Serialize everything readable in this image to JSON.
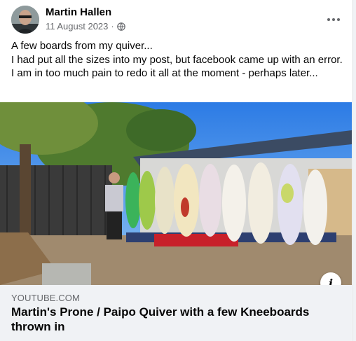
{
  "post": {
    "author": "Martin Hallen",
    "date": "11 August 2023",
    "privacy_icon": "globe-icon",
    "more_icon": "more-horizontal-icon",
    "text_lines": [
      "A few boards from my quiver...",
      "I had put all the sizes into my post, but facebook came up with an error. I am in too much pain to redo it all at the moment - perhaps later..."
    ]
  },
  "link_preview": {
    "domain": "YOUTUBE.COM",
    "title": "Martin's Prone / Paipo Quiver with a few Kneeboards thrown in",
    "info_label": "i"
  },
  "colors": {
    "text_primary": "#050505",
    "text_secondary": "#65676b",
    "link_box_bg": "#f0f2f5"
  }
}
